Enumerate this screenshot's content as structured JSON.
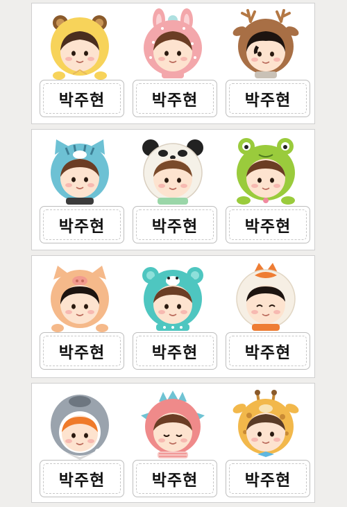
{
  "colors": {
    "background": "#efeeec",
    "card": "#ffffff",
    "card_border": "#cfcfcf",
    "tag_border": "#bdbdbd",
    "name_text": "#111111"
  },
  "sheets": [
    {
      "stickers": [
        {
          "costume": "yellow-bear-hood-icon",
          "name": "박주현"
        },
        {
          "costume": "pink-bunny-hood-icon",
          "name": "박주현"
        },
        {
          "costume": "brown-deer-hood-icon",
          "name": "박주현"
        }
      ]
    },
    {
      "stickers": [
        {
          "costume": "blue-tiger-hood-icon",
          "name": "박주현"
        },
        {
          "costume": "panda-hood-icon",
          "name": "박주현"
        },
        {
          "costume": "green-frog-hood-icon",
          "name": "박주현"
        }
      ]
    },
    {
      "stickers": [
        {
          "costume": "pig-hood-icon",
          "name": "박주현"
        },
        {
          "costume": "teal-bear-hood-icon",
          "name": "박주현"
        },
        {
          "costume": "fox-hood-icon",
          "name": "박주현"
        }
      ]
    },
    {
      "stickers": [
        {
          "costume": "penguin-hood-icon",
          "name": "박주현"
        },
        {
          "costume": "pink-dinosaur-hood-icon",
          "name": "박주현"
        },
        {
          "costume": "giraffe-hood-icon",
          "name": "박주현"
        }
      ]
    }
  ]
}
